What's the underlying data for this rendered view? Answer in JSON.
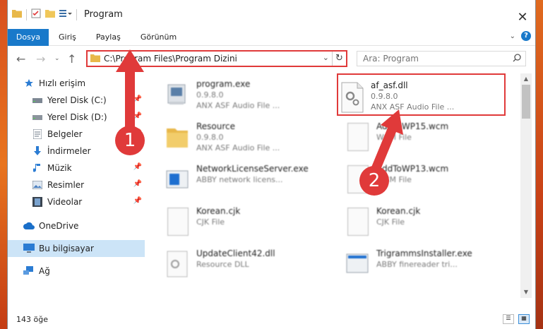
{
  "window": {
    "title": "Program"
  },
  "ribbon": {
    "tabs": [
      "Dosya",
      "Giriş",
      "Paylaş",
      "Görünüm"
    ]
  },
  "navbar": {
    "address": "C:\\Program Files\\Program Dizini",
    "search_placeholder": "Ara: Program"
  },
  "sidebar": {
    "items": [
      {
        "label": "Hızlı erişim",
        "icon": "star-icon"
      },
      {
        "label": "Yerel Disk (C:)",
        "icon": "drive-icon"
      },
      {
        "label": "Yerel Disk (D:)",
        "icon": "drive-icon"
      },
      {
        "label": "Belgeler",
        "icon": "documents-icon"
      },
      {
        "label": "İndirmeler",
        "icon": "download-icon"
      },
      {
        "label": "Müzik",
        "icon": "music-icon"
      },
      {
        "label": "Resimler",
        "icon": "pictures-icon"
      },
      {
        "label": "Videolar",
        "icon": "videos-icon"
      },
      {
        "label": "OneDrive",
        "icon": "cloud-icon"
      },
      {
        "label": "Bu bilgisayar",
        "icon": "computer-icon"
      },
      {
        "label": "Ağ",
        "icon": "network-icon"
      }
    ]
  },
  "files": [
    {
      "name": "program.exe",
      "meta1": "0.9.8.0",
      "meta2": "ANX ASF Audio File ..."
    },
    {
      "name": "af_asf.dll",
      "meta1": "0.9.8.0",
      "meta2": "ANX ASF Audio File ..."
    },
    {
      "name": "Resource",
      "meta1": "0.9.8.0",
      "meta2": "ANX ASF Audio File ..."
    },
    {
      "name": "AddToWP15.wcm",
      "meta1": "WCM File",
      "meta2": ""
    },
    {
      "name": "NetworkLicenseServer.exe",
      "meta1": "ABBY network licens...",
      "meta2": ""
    },
    {
      "name": "AddToWP13.wcm",
      "meta1": "WCM File",
      "meta2": ""
    },
    {
      "name": "Korean.cjk",
      "meta1": "CJK File",
      "meta2": ""
    },
    {
      "name": "Korean.cjk",
      "meta1": "CJK File",
      "meta2": ""
    },
    {
      "name": "UpdateClient42.dll",
      "meta1": "Resource DLL",
      "meta2": ""
    },
    {
      "name": "TrigrammsInstaller.exe",
      "meta1": "ABBY finereader tri...",
      "meta2": ""
    }
  ],
  "status": {
    "count": "143 öğe"
  },
  "callouts": {
    "one": "1",
    "two": "2"
  },
  "colors": {
    "accent": "#1979ca",
    "highlight": "#e03a3a",
    "selected": "#cce4f7"
  }
}
